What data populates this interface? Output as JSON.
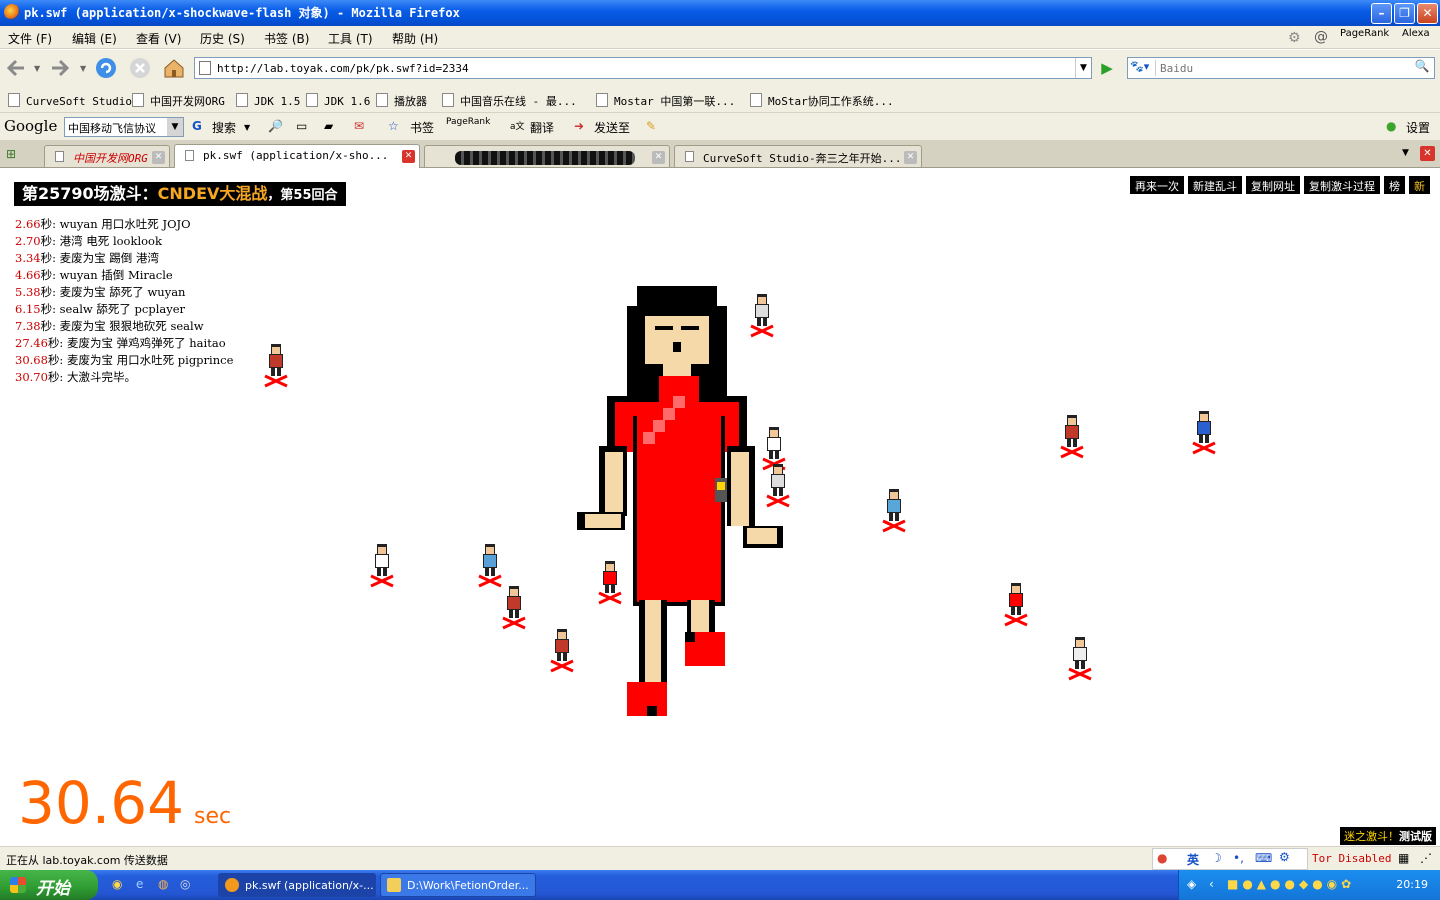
{
  "window": {
    "title": "pk.swf (application/x-shockwave-flash 对象) - Mozilla Firefox"
  },
  "menu": {
    "items": [
      "文件 (F)",
      "编辑 (E)",
      "查看 (V)",
      "历史 (S)",
      "书签 (B)",
      "工具 (T)",
      "帮助 (H)"
    ],
    "pagerank": "PageRank",
    "alexa": "Alexa"
  },
  "nav": {
    "url": "http://lab.toyak.com/pk/pk.swf?id=2334",
    "search_placeholder": "Baidu"
  },
  "bookmarks": [
    "CurveSoft Studio",
    "中国开发网ORG",
    "JDK 1.5",
    "JDK 1.6",
    "播放器",
    "中国音乐在线 - 最...",
    "Mostar 中国第一联...",
    "MoStar协同工作系统..."
  ],
  "google_toolbar": {
    "logo": "Google",
    "query": "中国移动飞信协议",
    "search": "搜索",
    "bookmarks": "书签",
    "pagerank": "PageRank",
    "translate": "翻译",
    "sendto": "发送至",
    "settings": "设置"
  },
  "tabs": [
    {
      "label": "中国开发网ORG"
    },
    {
      "label": "pk.swf (application/x-sho..."
    },
    {
      "label": ""
    },
    {
      "label": "CurveSoft Studio-奔三之年开始..."
    }
  ],
  "game": {
    "title_prefix": "第25790场激斗：",
    "title_highlight": "CNDEV大混战",
    "title_suffix": "，第55回合",
    "actions": [
      "再来一次",
      "新建乱斗",
      "复制网址",
      "复制激斗过程",
      "榜",
      "新"
    ],
    "log": [
      {
        "time": "2.66",
        "text": "秒: wuyan 用口水吐死 JOJO"
      },
      {
        "time": "2.70",
        "text": "秒: 港湾 电死 looklook"
      },
      {
        "time": "3.34",
        "text": "秒: 麦废为宝 踢倒 港湾"
      },
      {
        "time": "4.66",
        "text": "秒: wuyan 插倒 Miracle"
      },
      {
        "time": "5.38",
        "text": "秒: 麦废为宝 舔死了 wuyan"
      },
      {
        "time": "6.15",
        "text": "秒: sealw 舔死了 pcplayer"
      },
      {
        "time": "7.38",
        "text": "秒: 麦废为宝 狠狠地砍死 sealw"
      },
      {
        "time": "27.46",
        "text": "秒: 麦废为宝 弹鸡鸡弹死了 haitao"
      },
      {
        "time": "30.68",
        "text": "秒: 麦废为宝 用口水吐死 pigprince"
      },
      {
        "time": "30.70",
        "text": "秒: 大激斗完毕。"
      }
    ],
    "timer_value": "30.64",
    "timer_unit": "sec",
    "badge_prefix": "迷之激斗！",
    "badge_suffix": "测试版"
  },
  "status": {
    "text": "正在从 lab.toyak.com 传送数据",
    "ime": "英",
    "tor": "Tor Disabled"
  },
  "taskbar": {
    "start": "开始",
    "tasks": [
      "pk.swf (application/x-...",
      "D:\\Work\\FetionOrder..."
    ],
    "clock": "20:19"
  },
  "colors": {
    "accent": "#ff6600",
    "dress": "#ff0000",
    "hair": "#000000",
    "skin": "#f5d9a8"
  }
}
